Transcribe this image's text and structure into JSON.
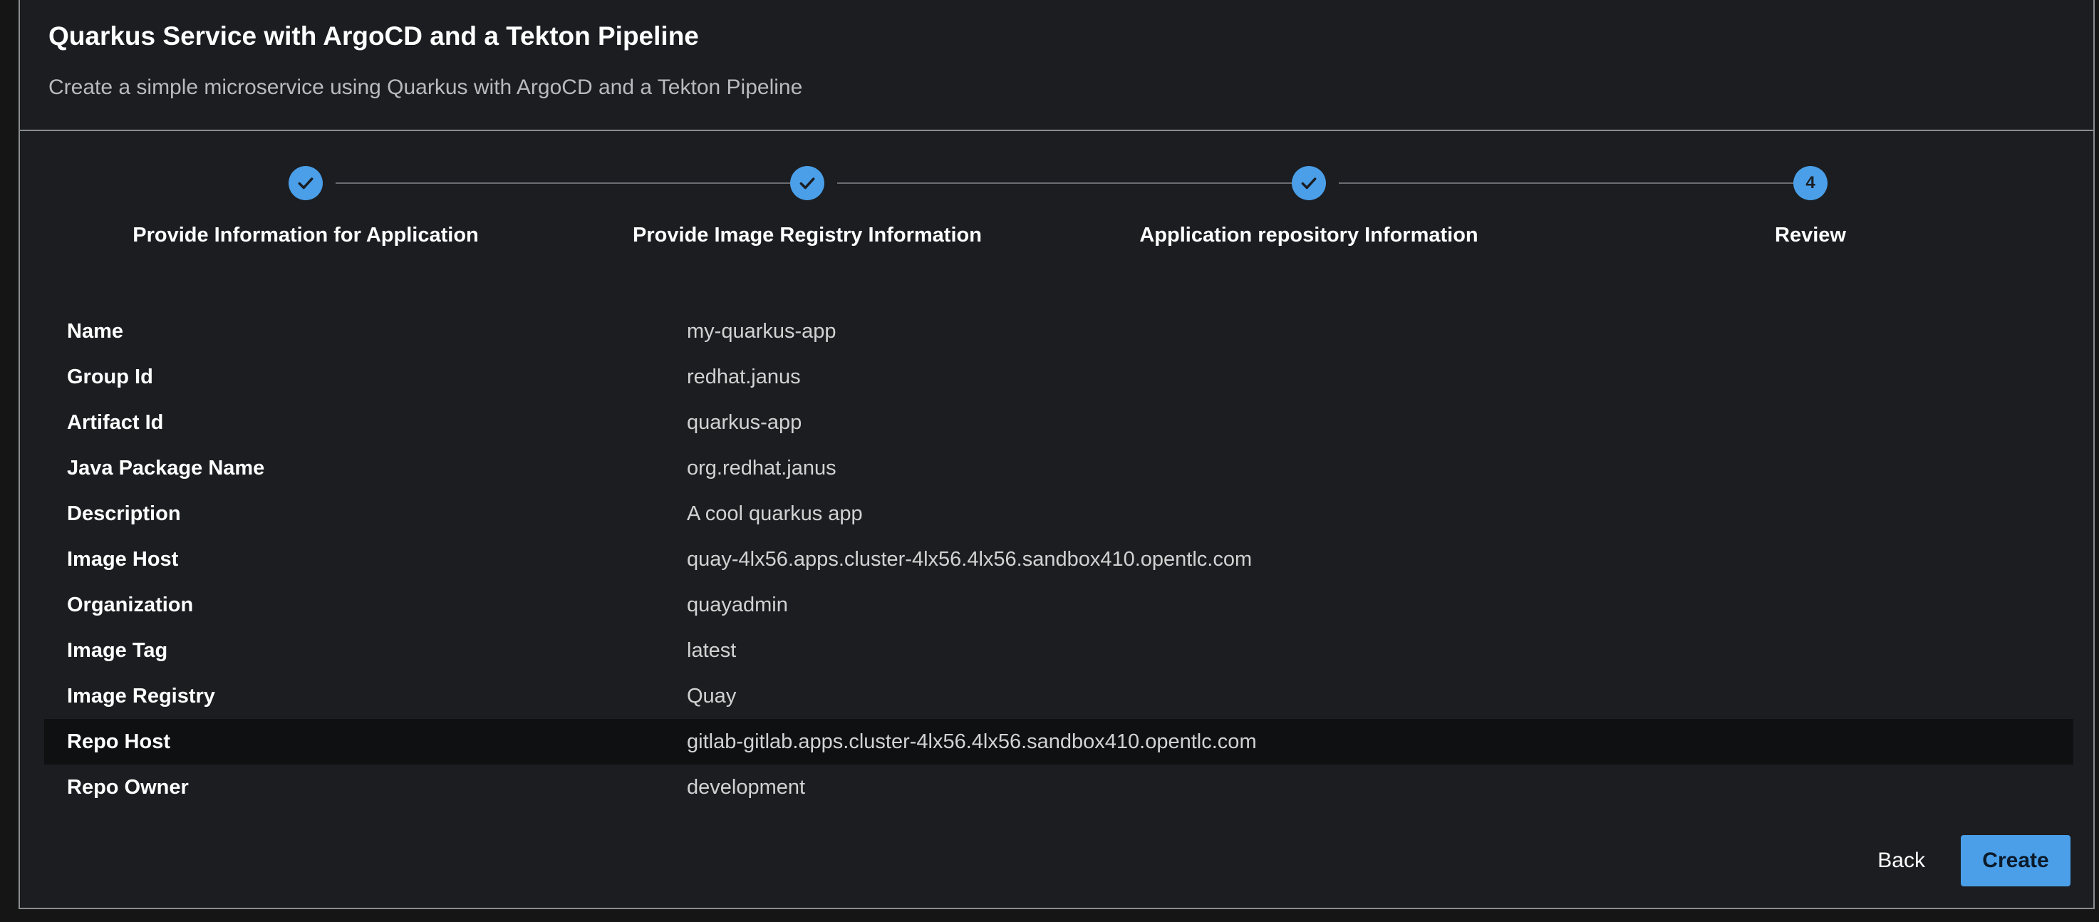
{
  "header": {
    "title": "Quarkus Service with ArgoCD and a Tekton Pipeline",
    "subtitle": "Create a simple microservice using Quarkus with ArgoCD and a Tekton Pipeline"
  },
  "stepper": {
    "steps": [
      {
        "label": "Provide Information for Application",
        "status": "completed"
      },
      {
        "label": "Provide Image Registry Information",
        "status": "completed"
      },
      {
        "label": "Application repository Information",
        "status": "completed"
      },
      {
        "label": "Review",
        "status": "active",
        "number": "4"
      }
    ]
  },
  "review": {
    "rows": [
      {
        "key": "Name",
        "value": "my-quarkus-app"
      },
      {
        "key": "Group Id",
        "value": "redhat.janus"
      },
      {
        "key": "Artifact Id",
        "value": "quarkus-app"
      },
      {
        "key": "Java Package Name",
        "value": "org.redhat.janus"
      },
      {
        "key": "Description",
        "value": "A cool quarkus app"
      },
      {
        "key": "Image Host",
        "value": "quay-4lx56.apps.cluster-4lx56.4lx56.sandbox410.opentlc.com"
      },
      {
        "key": "Organization",
        "value": "quayadmin"
      },
      {
        "key": "Image Tag",
        "value": "latest"
      },
      {
        "key": "Image Registry",
        "value": "Quay"
      },
      {
        "key": "Repo Host",
        "value": "gitlab-gitlab.apps.cluster-4lx56.4lx56.sandbox410.opentlc.com"
      },
      {
        "key": "Repo Owner",
        "value": "development"
      }
    ]
  },
  "actions": {
    "back_label": "Back",
    "create_label": "Create"
  },
  "colors": {
    "accent": "#4a9fe8",
    "background": "#1b1d21",
    "highlight_row": "#0f1012"
  }
}
